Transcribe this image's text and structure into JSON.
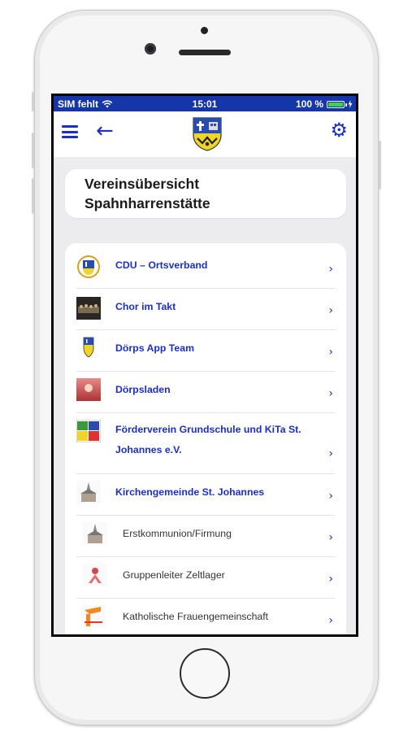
{
  "status": {
    "carrier": "SIM fehlt",
    "time": "15:01",
    "battery": "100 %",
    "battery_level": 1.0
  },
  "appbar": {
    "menu_icon": "hamburger-icon",
    "back_icon": "arrow-left-icon",
    "settings_icon": "gear-icon"
  },
  "page": {
    "title_line1": "Vereinsübersicht",
    "title_line2": "Spahnharrenstätte"
  },
  "clubs": [
    {
      "label": "CDU – Ortsverband",
      "chevron": "›"
    },
    {
      "label": "Chor im Takt",
      "chevron": "›"
    },
    {
      "label": "Dörps App Team",
      "chevron": "›"
    },
    {
      "label": "Dörpsladen",
      "chevron": "›"
    },
    {
      "label_line1": "Förderverein Grundschule und KiTa St.",
      "label_line2": "Johannes e.V.",
      "chevron": "›"
    },
    {
      "label": "Kirchengemeinde St. Johannes",
      "chevron": "›"
    },
    {
      "label": "Erstkommunion/Firmung",
      "chevron": "›"
    },
    {
      "label": "Gruppenleiter Zeltlager",
      "chevron": "›"
    },
    {
      "label": "Katholische Frauengemeinschaft",
      "chevron": "›"
    }
  ],
  "colors": {
    "accent": "#1a2fc8",
    "statusbar": "#1536a8",
    "background": "#ececef"
  }
}
